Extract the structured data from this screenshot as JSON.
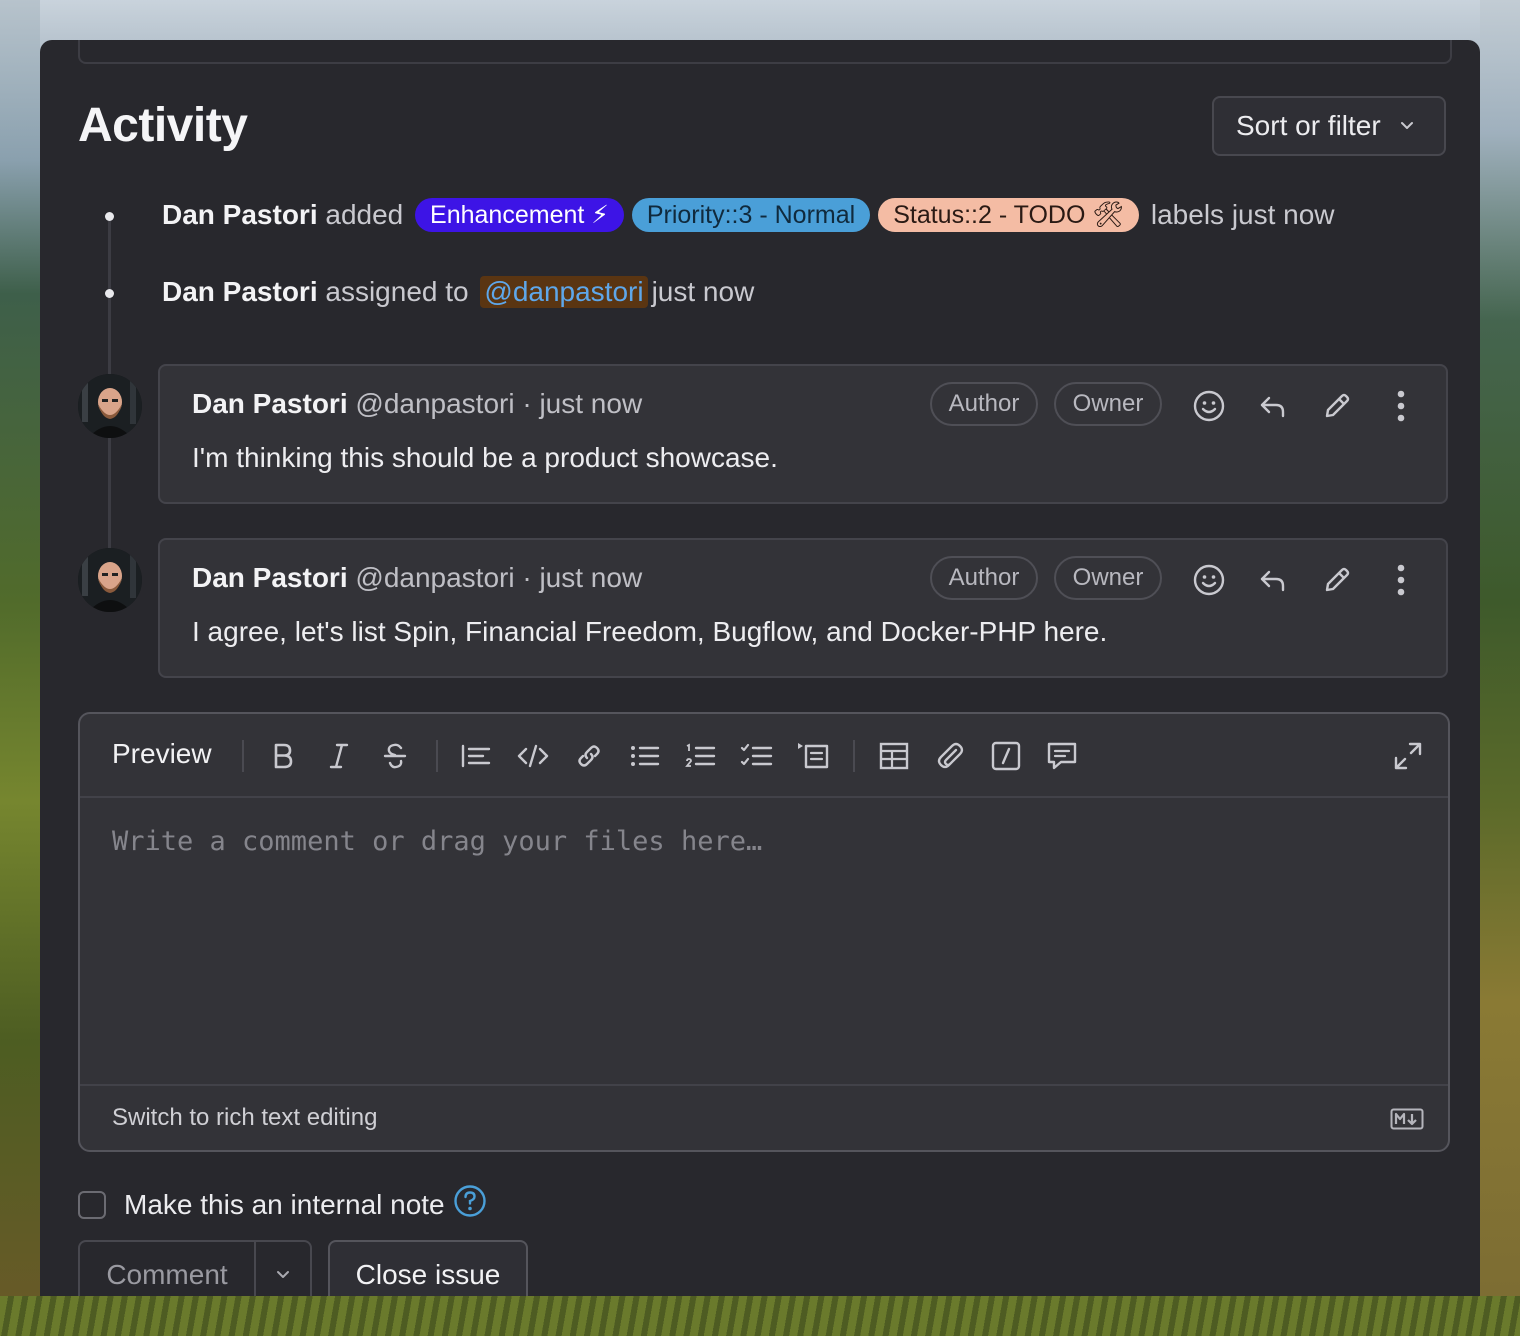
{
  "activity": {
    "title": "Activity",
    "sort_label": "Sort or filter"
  },
  "events": [
    {
      "author": "Dan Pastori",
      "action": "added",
      "labels": [
        "Enhancement ⚡",
        "Priority::3 - Normal",
        "Status::2 - TODO 🛠"
      ],
      "label_colors": [
        "#3d14e6",
        "#4a9fd8",
        "#f4bca4"
      ],
      "suffix": "labels just now"
    },
    {
      "author": "Dan Pastori",
      "action": "assigned to",
      "mention": "@danpastori",
      "suffix": "just now"
    }
  ],
  "comments": [
    {
      "author": "Dan Pastori",
      "meta": "@danpastori · just now",
      "badges": [
        "Author",
        "Owner"
      ],
      "body": "I'm thinking this should be a product showcase."
    },
    {
      "author": "Dan Pastori",
      "meta": "@danpastori · just now",
      "badges": [
        "Author",
        "Owner"
      ],
      "body": "I agree, let's list Spin, Financial Freedom, Bugflow, and Docker-PHP here."
    }
  ],
  "editor": {
    "tab": "Preview",
    "placeholder": "Write a comment or drag your files here…",
    "switch_label": "Switch to rich text editing",
    "toolbar_icons": [
      "bold-icon",
      "italic-icon",
      "strikethrough-icon",
      "quote-icon",
      "code-icon",
      "link-icon",
      "bullet-list-icon",
      "numbered-list-icon",
      "task-list-icon",
      "collapsible-icon",
      "table-icon",
      "attach-icon",
      "slash-command-icon",
      "comment-template-icon",
      "fullscreen-icon"
    ]
  },
  "internal_note": {
    "label": "Make this an internal note",
    "checked": false
  },
  "actions": {
    "comment_label": "Comment",
    "close_label": "Close issue"
  },
  "colors": {
    "panel": "#28282d",
    "accent_link": "#5ea7ea"
  }
}
